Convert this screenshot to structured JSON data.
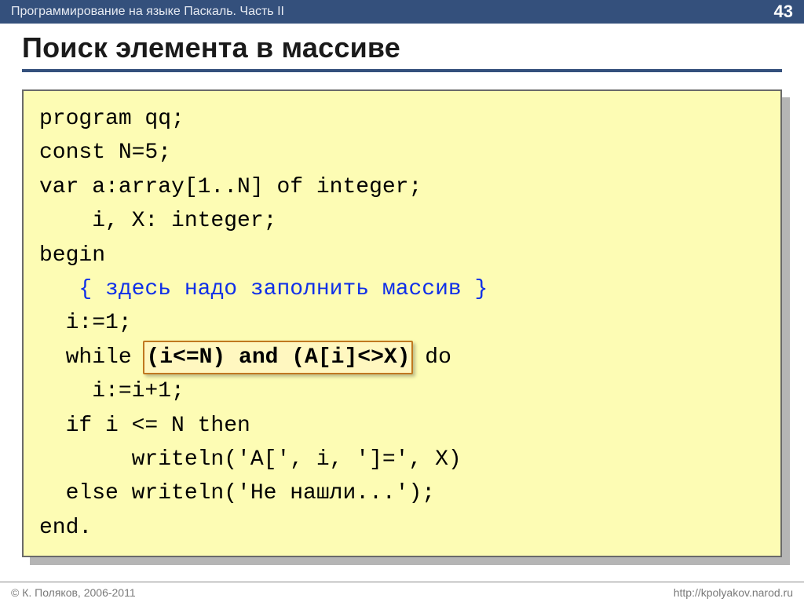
{
  "header": {
    "course_title": "Программирование на языке Паскаль. Часть II",
    "page_number": "43"
  },
  "slide": {
    "title": "Поиск элемента в массиве"
  },
  "code": {
    "l1": "program qq;",
    "l2": "const N=5;",
    "l3": "var a:array[1..N] of integer;",
    "l4": "    i, X: integer;",
    "l5": "begin",
    "l6_indent": "   ",
    "l6_comment": "{ здесь надо заполнить массив }",
    "l7": "  i:=1;",
    "l8_pre": "  while ",
    "l8_hl": "(i<=N) and (A[i]<>X)",
    "l8_post": " do",
    "l9": "    i:=i+1;",
    "l10": "  if i <= N then",
    "l11": "       writeln('A[', i, ']=', X)",
    "l12": "  else writeln('Не нашли...');",
    "l13": "end."
  },
  "footer": {
    "copyright": "© К. Поляков, 2006-2011",
    "url": "http://kpolyakov.narod.ru"
  }
}
